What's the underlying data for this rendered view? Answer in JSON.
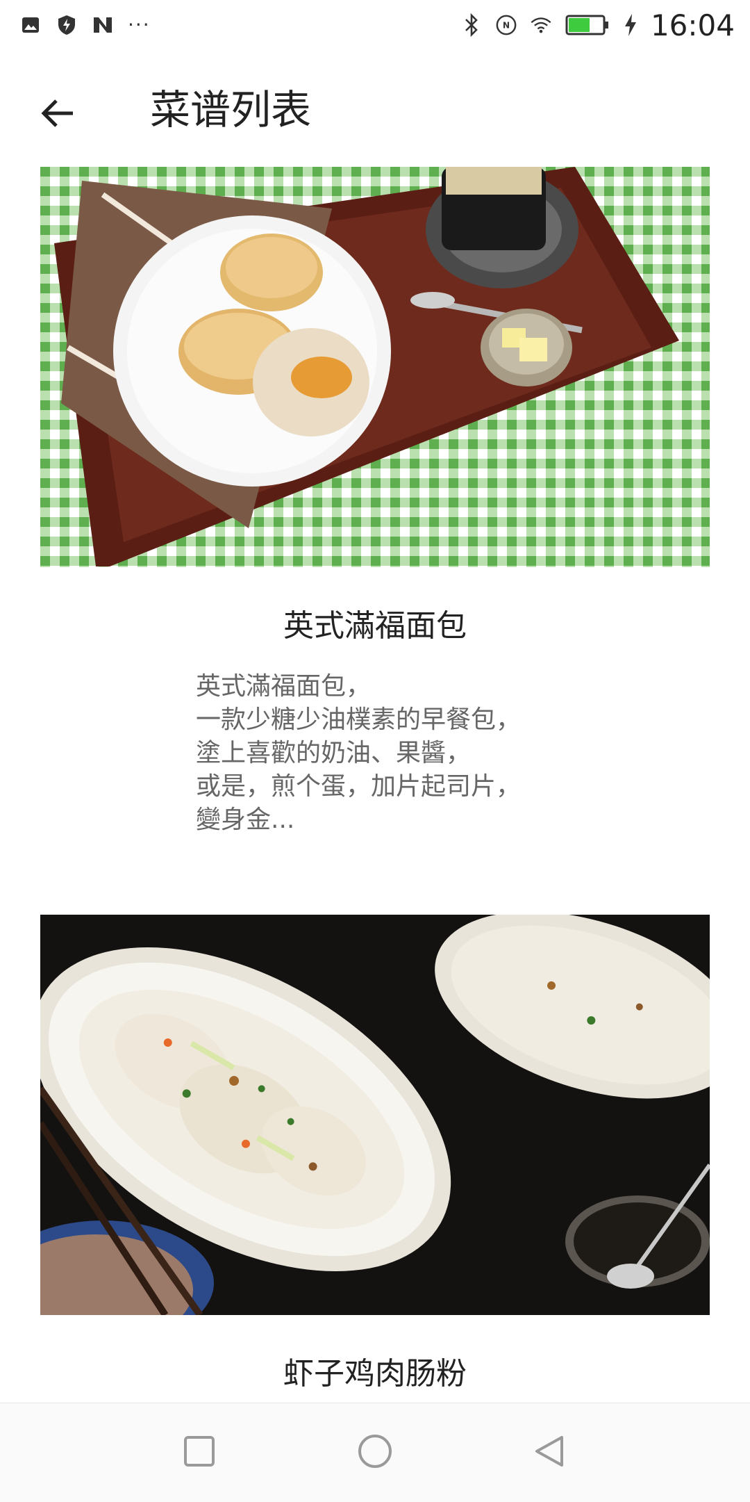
{
  "status_bar": {
    "time": "16:04",
    "left_icons": [
      "image-icon",
      "shield-icon",
      "n-logo-icon",
      "more-dots-icon"
    ],
    "right_icons": [
      "bluetooth-icon",
      "nfc-icon",
      "wifi-icon",
      "battery-icon",
      "charging-icon"
    ],
    "dots": "···",
    "battery_level": 0.6
  },
  "app_bar": {
    "title": "菜谱列表",
    "back_icon": "arrow-left-icon"
  },
  "recipes": [
    {
      "title": "英式滿福面包",
      "description": "英式滿福面包，\n一款少糖少油樸素的早餐包，\n塗上喜歡的奶油、果醬，\n或是，煎个蛋，加片起司片，\n變身金..."
    },
    {
      "title": "虾子鸡肉肠粉",
      "description": ""
    }
  ],
  "nav_bar": {
    "icons": [
      "recent-apps-icon",
      "home-icon",
      "back-icon"
    ]
  },
  "colors": {
    "gingham_green": "#7cc36a",
    "tray_wood": "#5a1e14",
    "dark_bg": "#141210",
    "text_primary": "#222222",
    "text_secondary": "#666666",
    "battery_green": "#3ecb3e"
  }
}
